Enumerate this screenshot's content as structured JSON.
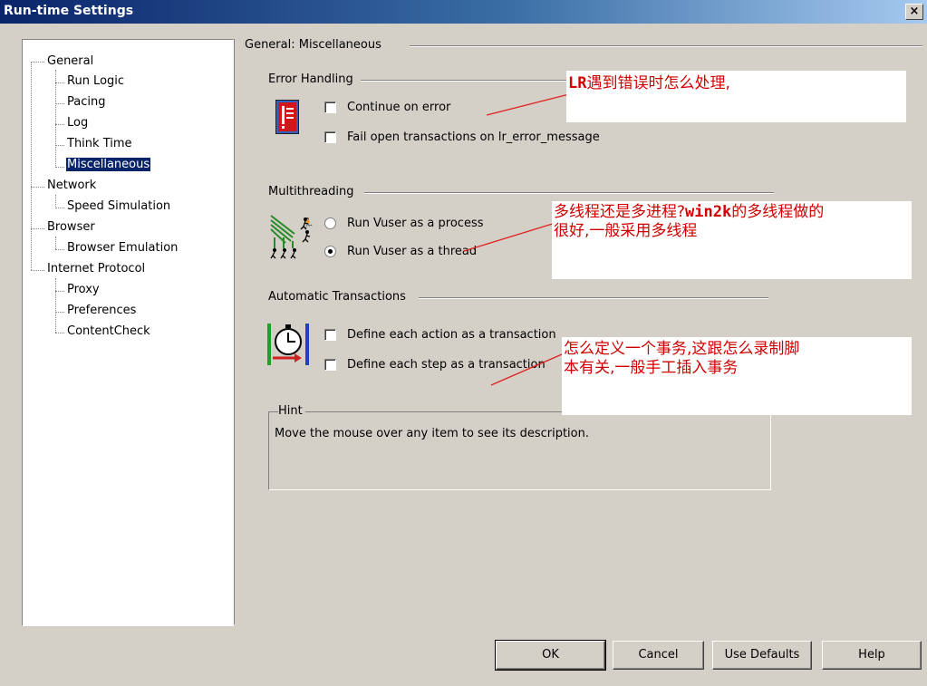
{
  "window": {
    "title": "Run-time Settings",
    "close": "×"
  },
  "tree": {
    "general": "General",
    "run_logic": "Run Logic",
    "pacing": "Pacing",
    "log": "Log",
    "think_time": "Think Time",
    "miscellaneous": "Miscellaneous",
    "network": "Network",
    "speed_simulation": "Speed Simulation",
    "browser": "Browser",
    "browser_emulation": "Browser Emulation",
    "internet_protocol": "Internet Protocol",
    "proxy": "Proxy",
    "preferences": "Preferences",
    "content_check": "ContentCheck",
    "selected": "Miscellaneous"
  },
  "panel": {
    "title": "General: Miscellaneous",
    "error_handling": {
      "title": "Error Handling",
      "continue_on_error": "Continue on error",
      "fail_open_transactions": "Fail open transactions on lr_error_message"
    },
    "multithreading": {
      "title": "Multithreading",
      "run_as_process": "Run Vuser as a process",
      "run_as_thread": "Run Vuser as a thread",
      "selected": "Run Vuser as a thread"
    },
    "automatic_transactions": {
      "title": "Automatic Transactions",
      "define_action": "Define each action as a transaction",
      "define_step": "Define each step as a transaction"
    },
    "hint": {
      "title": "Hint",
      "text": "Move the mouse over any item to see its description."
    }
  },
  "annotations": {
    "note1_bold": "LR",
    "note1_rest": "遇到错误时怎么处理,",
    "note2_a": "多线程还是多进程?",
    "note2_bold": "win2k",
    "note2_b": "的多线程做的",
    "note2_line2": "很好,一般采用多线程",
    "note3_line1": "怎么定义一个事务,这跟怎么录制脚",
    "note3_line2": "本有关,一般手工插入事务"
  },
  "buttons": {
    "ok": "OK",
    "cancel": "Cancel",
    "use_defaults": "Use Defaults",
    "help": "Help"
  },
  "colors": {
    "title_bar": "#0a246a",
    "annotation_text": "#d00000",
    "annotation_line": "#e02020",
    "selection": "#0a246a"
  },
  "icons": {
    "error_handling": "error-document-icon",
    "multithreading": "running-users-icon",
    "transactions": "stopwatch-icon"
  }
}
